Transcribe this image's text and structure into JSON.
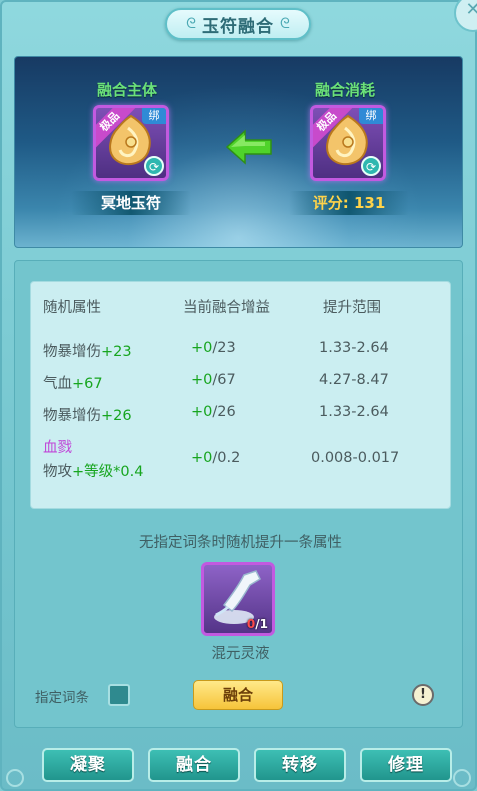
{
  "window": {
    "title": "玉符融合",
    "close_symbol": "✕"
  },
  "fusion": {
    "main_label": "融合主体",
    "cost_label": "融合消耗",
    "main_item": {
      "quality": "极品",
      "bind": "绑",
      "name": "冥地玉符"
    },
    "cost_item": {
      "quality": "极品",
      "bind": "绑",
      "score": "评分: 131"
    },
    "arrow_color": "#4fd32a"
  },
  "attributes": {
    "headers": [
      "随机属性",
      "当前融合增益",
      "提升范围"
    ],
    "rows": [
      {
        "name": "物暴增伤",
        "value": "+23",
        "gain_plus": "+0",
        "gain_max": "/23",
        "range": "1.33-2.64"
      },
      {
        "name": "气血",
        "value": "+67",
        "gain_plus": "+0",
        "gain_max": "/67",
        "range": "4.27-8.47"
      },
      {
        "name": "物暴增伤",
        "value": "+26",
        "gain_plus": "+0",
        "gain_max": "/26",
        "range": "1.33-2.64"
      },
      {
        "special": "血戮",
        "name": "物攻",
        "value": "+等级*0.4",
        "gain_plus": "+0",
        "gain_max": "/0.2",
        "range": "0.008-0.017"
      }
    ]
  },
  "hint": "无指定词条时随机提升一条属性",
  "material": {
    "name": "混元灵液",
    "count_have": "0",
    "count_need": "/1"
  },
  "controls": {
    "specify_label": "指定词条",
    "fuse_button": "融合",
    "info_symbol": "!"
  },
  "tabs": [
    "凝聚",
    "融合",
    "转移",
    "修理"
  ],
  "icons": {
    "refresh": "refresh-icon",
    "arrow": "arrow-left-icon",
    "info": "info-icon",
    "close": "close-icon"
  },
  "colors": {
    "positive": "#17a51f",
    "special_attr": "#c046d8",
    "quality_border": "#c25ae0",
    "fuse_button": "#f6c43a",
    "tab_button": "#21958d"
  }
}
